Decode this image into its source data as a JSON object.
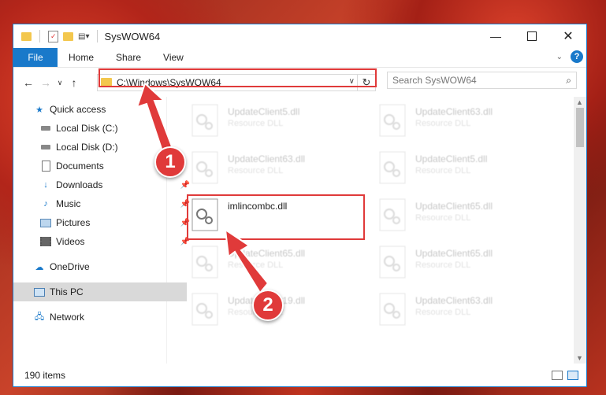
{
  "window": {
    "title": "SysWOW64"
  },
  "ribbon": {
    "tabs": [
      "File",
      "Home",
      "Share",
      "View"
    ],
    "help_label": "?"
  },
  "address": {
    "path": "C:\\Windows\\SysWOW64"
  },
  "search": {
    "placeholder": "Search SysWOW64"
  },
  "sidebar": {
    "items": [
      {
        "label": "Quick access",
        "icon": "star-icon"
      },
      {
        "label": "Local Disk (C:)",
        "icon": "drive-icon"
      },
      {
        "label": "Local Disk (D:)",
        "icon": "drive-icon"
      },
      {
        "label": "Documents",
        "icon": "documents-icon"
      },
      {
        "label": "Downloads",
        "icon": "download-icon",
        "pinned": true
      },
      {
        "label": "Music",
        "icon": "music-icon",
        "pinned": true
      },
      {
        "label": "Pictures",
        "icon": "pictures-icon",
        "pinned": true
      },
      {
        "label": "Videos",
        "icon": "videos-icon",
        "pinned": true
      },
      {
        "label": "OneDrive",
        "icon": "cloud-icon"
      },
      {
        "label": "This PC",
        "icon": "computer-icon",
        "selected": true
      },
      {
        "label": "Network",
        "icon": "network-icon"
      }
    ]
  },
  "files": [
    {
      "name": "UpdateClient5.dll",
      "type": "Resource DLL"
    },
    {
      "name": "UpdateClient63.dll",
      "type": "Resource DLL"
    },
    {
      "name": "UpdateClient63.dll",
      "type": "Resource DLL"
    },
    {
      "name": "UpdateClient5.dll",
      "type": "Resource DLL"
    },
    {
      "name": "imlincombc.dll",
      "type": ""
    },
    {
      "name": "UpdateClient65.dll",
      "type": "Resource DLL"
    },
    {
      "name": "UpdateClient65.dll",
      "type": "Resource DLL"
    },
    {
      "name": "UpdateClient65.dll",
      "type": "Resource DLL"
    },
    {
      "name": "UpdateClient19.dll",
      "type": "Resource DLL"
    },
    {
      "name": "UpdateClient63.dll",
      "type": "Resource DLL"
    }
  ],
  "status": {
    "item_count": "190 items"
  },
  "callouts": [
    "1",
    "2"
  ],
  "colors": {
    "accent": "#1979ca",
    "highlight": "#e03a3a"
  }
}
